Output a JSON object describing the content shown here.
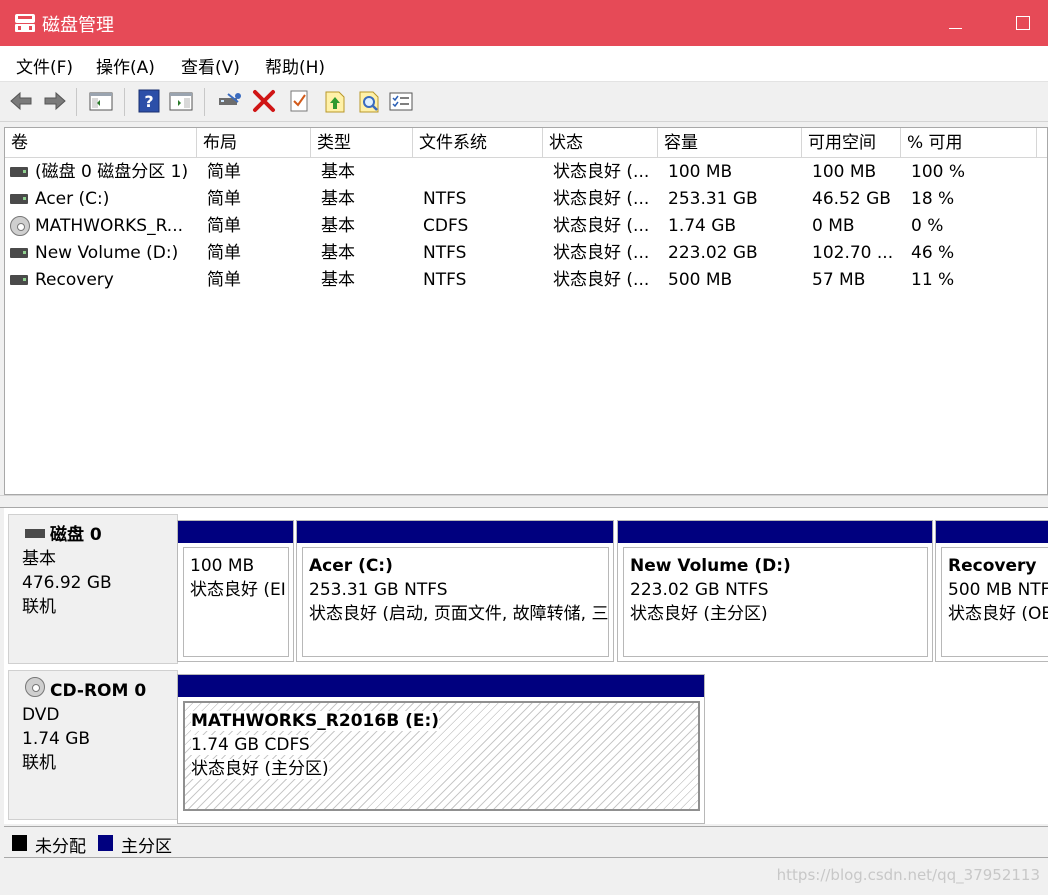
{
  "window": {
    "title": "磁盘管理"
  },
  "menu": {
    "items": [
      "文件(F)",
      "操作(A)",
      "查看(V)",
      "帮助(H)"
    ]
  },
  "toolbar": {
    "icons": [
      "back-arrow-icon",
      "forward-arrow-icon",
      "console-tree-icon",
      "help-icon",
      "show-hide-icon",
      "connect-drive-icon",
      "delete-icon",
      "properties-icon",
      "export-icon",
      "search-icon",
      "list-view-icon"
    ]
  },
  "volume_list": {
    "columns": [
      "卷",
      "布局",
      "类型",
      "文件系统",
      "状态",
      "容量",
      "可用空间",
      "% 可用"
    ],
    "rows": [
      {
        "icon": "disk",
        "volume": "(磁盘 0 磁盘分区 1)",
        "layout": "简单",
        "type": "基本",
        "fs": "",
        "status": "状态良好 (...",
        "capacity": "100 MB",
        "free": "100 MB",
        "pct": "100 %"
      },
      {
        "icon": "disk",
        "volume": "Acer (C:)",
        "layout": "简单",
        "type": "基本",
        "fs": "NTFS",
        "status": "状态良好 (...",
        "capacity": "253.31 GB",
        "free": "46.52 GB",
        "pct": "18 %"
      },
      {
        "icon": "cd",
        "volume": "MATHWORKS_R...",
        "layout": "简单",
        "type": "基本",
        "fs": "CDFS",
        "status": "状态良好 (...",
        "capacity": "1.74 GB",
        "free": "0 MB",
        "pct": "0 %"
      },
      {
        "icon": "disk",
        "volume": "New Volume (D:)",
        "layout": "简单",
        "type": "基本",
        "fs": "NTFS",
        "status": "状态良好 (...",
        "capacity": "223.02 GB",
        "free": "102.70 ...",
        "pct": "46 %"
      },
      {
        "icon": "disk",
        "volume": "Recovery",
        "layout": "简单",
        "type": "基本",
        "fs": "NTFS",
        "status": "状态良好 (...",
        "capacity": "500 MB",
        "free": "57 MB",
        "pct": "11 %"
      }
    ]
  },
  "disks": [
    {
      "name": "磁盘 0",
      "kind": "基本",
      "size": "476.92 GB",
      "state": "联机",
      "partitions": [
        {
          "name": "",
          "detail": "100 MB",
          "status": "状态良好 (EI"
        },
        {
          "name": "Acer  (C:)",
          "detail": "253.31 GB NTFS",
          "status": "状态良好 (启动, 页面文件, 故障转储, 三"
        },
        {
          "name": "New Volume  (D:)",
          "detail": "223.02 GB NTFS",
          "status": "状态良好 (主分区)"
        },
        {
          "name": "Recovery",
          "detail": "500 MB NTF",
          "status": "状态良好 (OE"
        }
      ]
    },
    {
      "name": "CD-ROM 0",
      "kind": "DVD",
      "size": "1.74 GB",
      "state": "联机",
      "partitions": [
        {
          "name": "MATHWORKS_R2016B  (E:)",
          "detail": "1.74 GB CDFS",
          "status": "状态良好 (主分区)"
        }
      ]
    }
  ],
  "legend": {
    "items": [
      {
        "label": "未分配",
        "color": "#000000"
      },
      {
        "label": "主分区",
        "color": "#00007f"
      }
    ]
  },
  "colors": {
    "titlebar": "#e64a57",
    "partition_bar": "#00007f"
  },
  "watermark": "https://blog.csdn.net/qq_37952113"
}
